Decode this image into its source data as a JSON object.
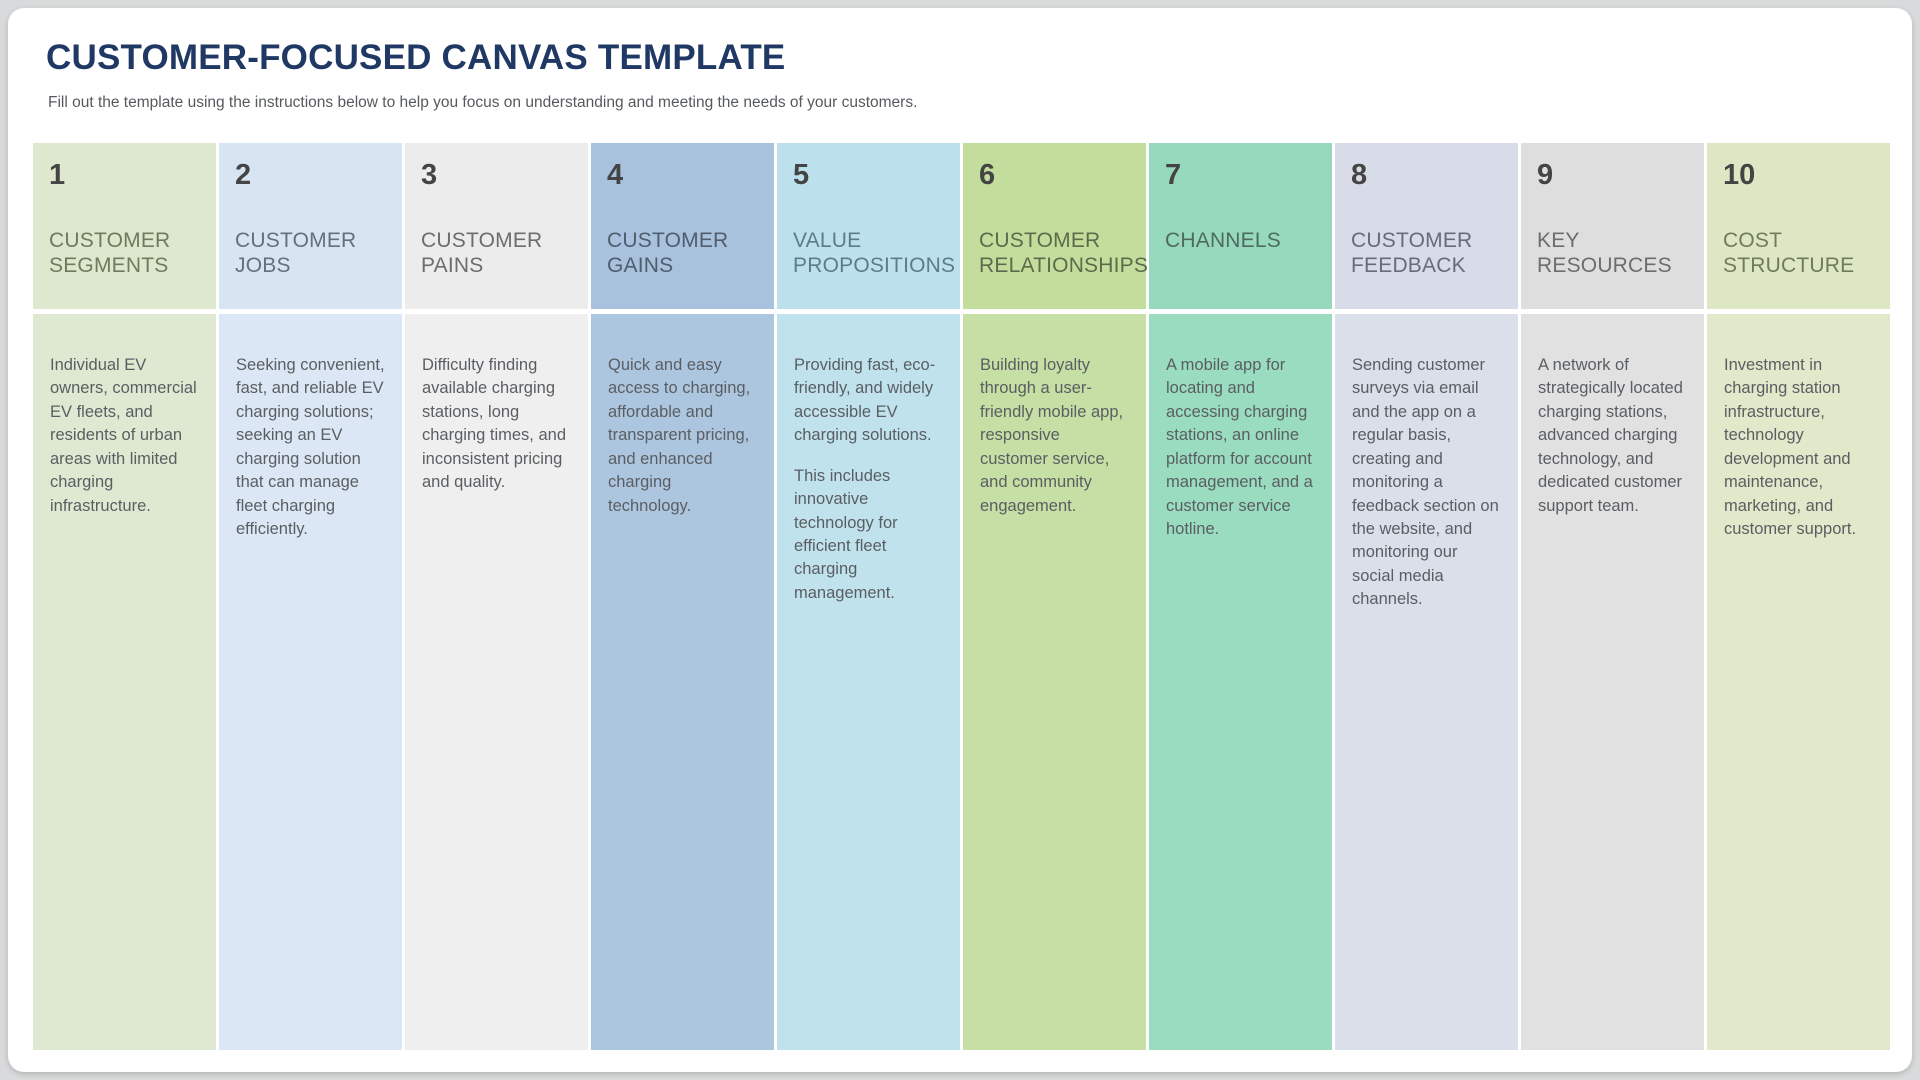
{
  "header": {
    "title": "CUSTOMER-FOCUSED CANVAS TEMPLATE",
    "subtitle": "Fill out the template using the instructions below to help you focus on understanding and meeting the needs of your customers.",
    "title_color": "#1f3864",
    "subtitle_color": "#565a5e"
  },
  "page": {
    "background": "#d9dadb",
    "card_background": "#ffffff"
  },
  "columns": [
    {
      "number": "1",
      "label": "CUSTOMER\nSEGMENTS",
      "header_bg": "#dde8ce",
      "body_bg": "#dfe9d2",
      "label_color": "#6f7a5f",
      "paragraphs": [
        "Individual EV owners, commercial EV fleets, and residents of urban areas with limited charging infrastructure."
      ]
    },
    {
      "number": "2",
      "label": "CUSTOMER\nJOBS",
      "header_bg": "#d7e4f2",
      "body_bg": "#dbe7f4",
      "label_color": "#63707e",
      "paragraphs": [
        "Seeking convenient, fast, and reliable EV charging solutions; seeking an EV charging solution that can manage fleet charging efficiently."
      ]
    },
    {
      "number": "3",
      "label": "CUSTOMER\nPAINS",
      "header_bg": "#ececec",
      "body_bg": "#efefef",
      "label_color": "#6d6d6d",
      "paragraphs": [
        "Difficulty finding available charging stations, long charging times, and inconsistent pricing and quality."
      ]
    },
    {
      "number": "4",
      "label": "CUSTOMER\nGAINS",
      "header_bg": "#a8c2de",
      "body_bg": "#adc6e0",
      "label_color": "#4f5d6d",
      "paragraphs": [
        "Quick and easy access to charging, affordable and transparent pricing, and enhanced charging technology."
      ]
    },
    {
      "number": "5",
      "label": "VALUE\nPROPOSITIONS",
      "header_bg": "#bde1ec",
      "body_bg": "#c0e2ed",
      "label_color": "#5b7d88",
      "paragraphs": [
        "Providing fast, eco-friendly, and widely accessible EV charging solutions.",
        "This includes innovative technology for efficient fleet charging management."
      ]
    },
    {
      "number": "6",
      "label": "CUSTOMER\nRELATIONSHIPS",
      "header_bg": "#c3de9c",
      "body_bg": "#c6dfa4",
      "label_color": "#5e6a4c",
      "paragraphs": [
        "Building loyalty through a user-friendly mobile app, responsive customer service, and community engagement."
      ]
    },
    {
      "number": "7",
      "label": "CHANNELS",
      "header_bg": "#96d9bc",
      "body_bg": "#9adcbf",
      "label_color": "#4f6b60",
      "paragraphs": [
        "A mobile app for locating and accessing charging stations, an online platform for account management, and a customer service hotline."
      ]
    },
    {
      "number": "8",
      "label": "CUSTOMER\nFEEDBACK",
      "header_bg": "#d8dce8",
      "body_bg": "#dbdfea",
      "label_color": "#666c78",
      "paragraphs": [
        "Sending customer surveys via email and the app on a regular basis, creating and monitoring a feedback section on the website, and monitoring our social media channels."
      ]
    },
    {
      "number": "9",
      "label": "KEY\nRESOURCES",
      "header_bg": "#dedede",
      "body_bg": "#e1e1e1",
      "label_color": "#6d6d6d",
      "paragraphs": [
        "A network of strategically located charging stations, advanced charging technology, and dedicated customer support team."
      ]
    },
    {
      "number": "10",
      "label": "COST\nSTRUCTURE",
      "header_bg": "#dee7c4",
      "body_bg": "#e0e9c9",
      "label_color": "#6f7a5f",
      "paragraphs": [
        "Investment in charging station infrastructure, technology development and maintenance, marketing, and customer support."
      ]
    }
  ]
}
